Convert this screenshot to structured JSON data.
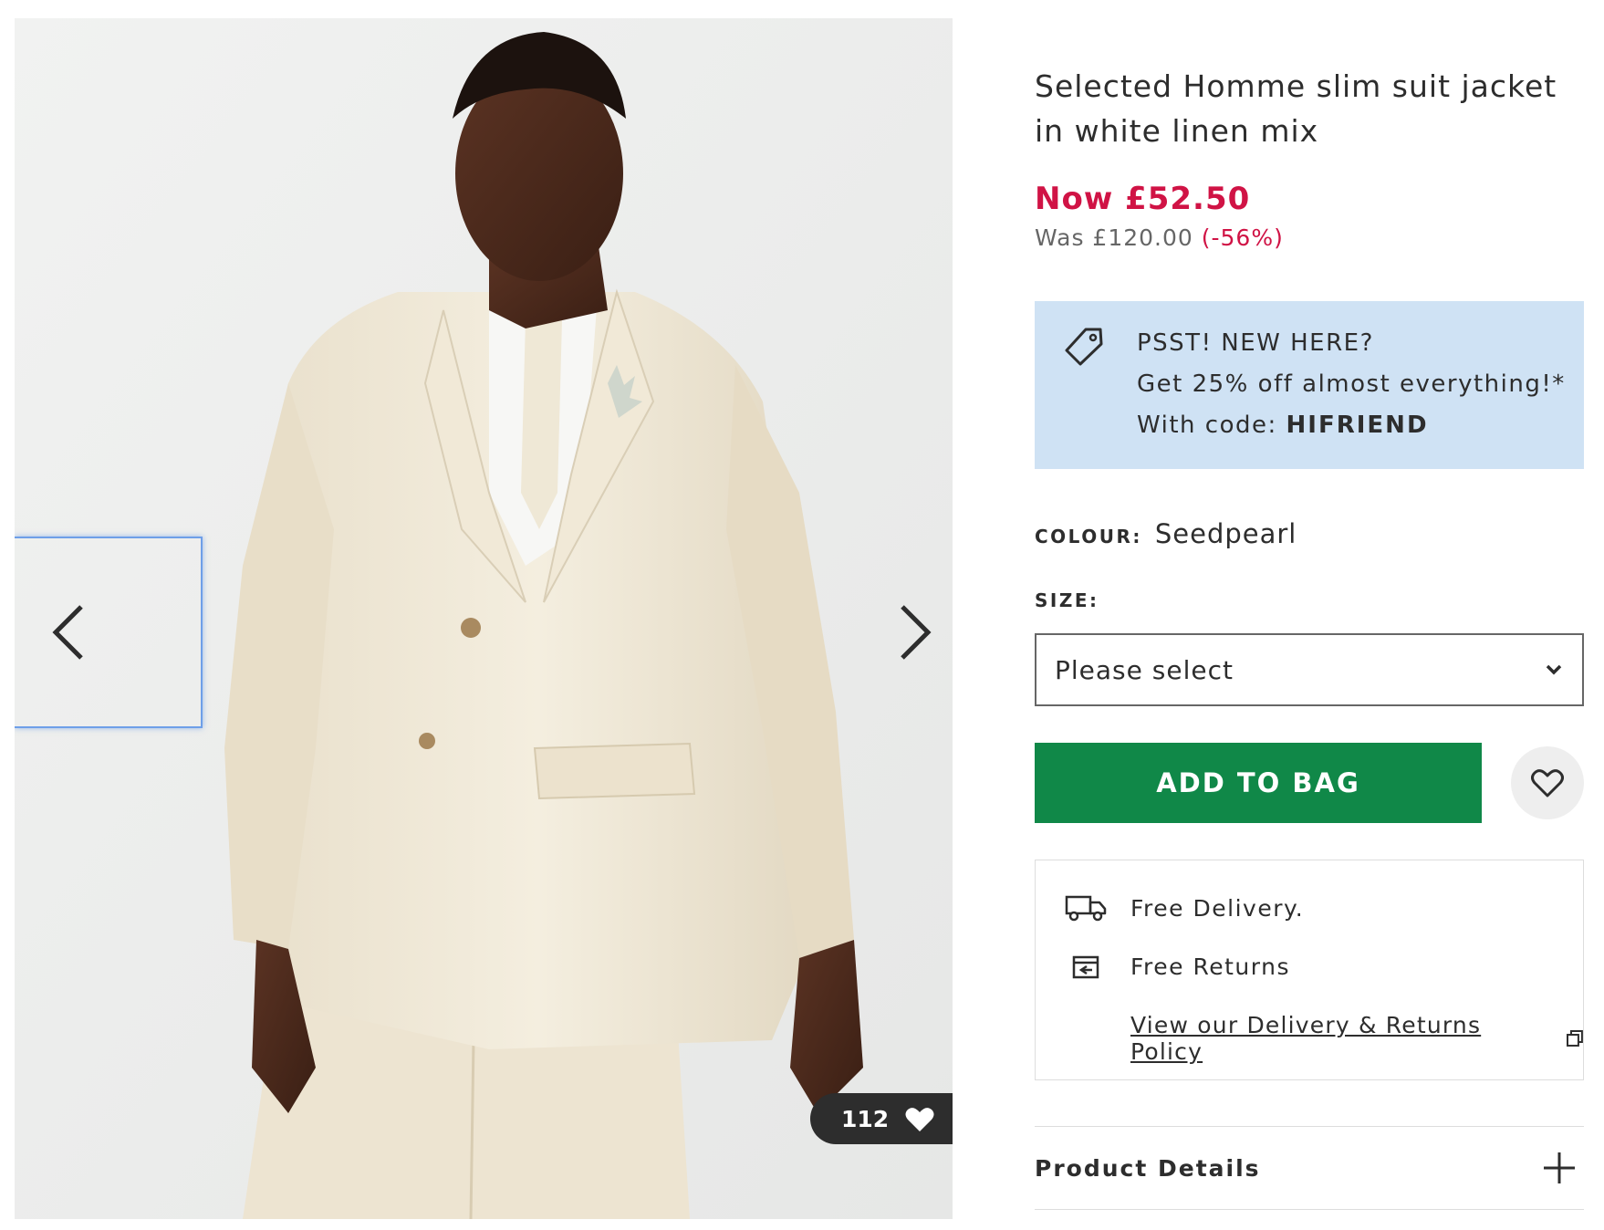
{
  "gallery": {
    "saves_count": "112",
    "prev_icon": "chevron-left-icon",
    "next_icon": "chevron-right-icon",
    "saves_icon": "heart-filled-icon"
  },
  "product": {
    "title": "Selected Homme slim suit jacket in white linen mix",
    "price_now": "Now £52.50",
    "price_was": "Was £120.00",
    "discount": "(-56%)"
  },
  "promo": {
    "icon": "tag-icon",
    "line1": "PSST! NEW HERE?",
    "line2": "Get 25% off almost everything!*",
    "line3_prefix": "With code: ",
    "code": "HIFRIEND"
  },
  "colour": {
    "label": "COLOUR:",
    "value": "Seedpearl"
  },
  "size": {
    "label": "SIZE:",
    "selected": "Please select"
  },
  "actions": {
    "add_to_bag": "ADD TO BAG",
    "wishlist_icon": "heart-outline-icon"
  },
  "delivery": {
    "free_delivery": "Free Delivery.",
    "free_returns": "Free Returns",
    "policy_link": "View our Delivery & Returns Policy"
  },
  "details": {
    "label": "Product Details"
  },
  "colors": {
    "sale_red": "#d01345",
    "add_bag_green": "#108848",
    "promo_blue": "#cfe2f4",
    "text_dark": "#2d2d2d"
  }
}
